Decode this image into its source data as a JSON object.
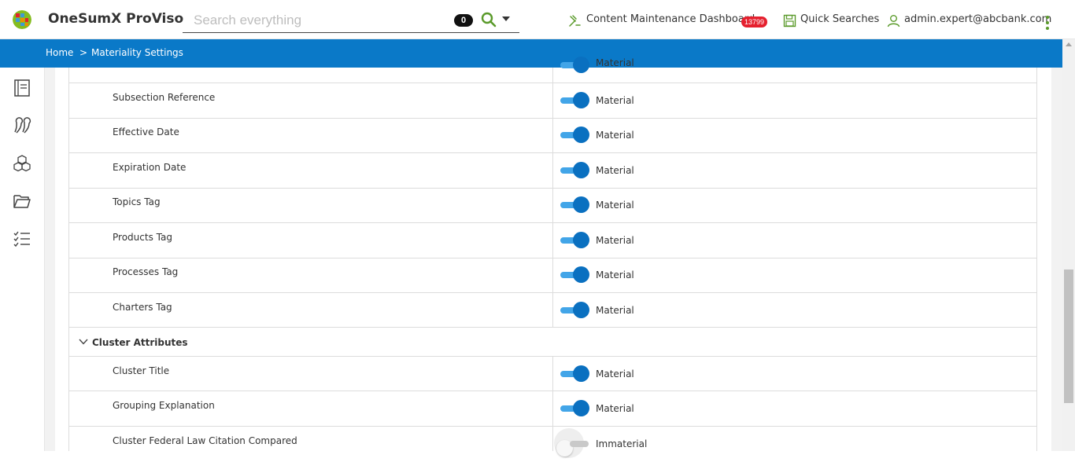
{
  "header": {
    "app_title": "OneSumX ProViso",
    "search_placeholder": "Search everything",
    "search_count": "0",
    "dashboard_label": "Content Maintenance Dashboard",
    "dashboard_badge": "13799",
    "quick_searches_label": "Quick Searches",
    "user_label": "admin.expert@abcbank.com"
  },
  "breadcrumb": {
    "home": "Home",
    "separator": ">",
    "current": "Materiality Settings"
  },
  "colors": {
    "brand_blue": "#0a79c8",
    "toggle_on": "#0a70c0",
    "badge_red": "#e5202e",
    "icon_green": "#5a9a2a"
  },
  "rows": [
    {
      "label": "Subsection Reference",
      "status": "Material"
    },
    {
      "label": "Effective Date",
      "status": "Material"
    },
    {
      "label": "Expiration Date",
      "status": "Material"
    },
    {
      "label": "Topics Tag",
      "status": "Material"
    },
    {
      "label": "Products Tag",
      "status": "Material"
    },
    {
      "label": "Processes Tag",
      "status": "Material"
    },
    {
      "label": "Charters Tag",
      "status": "Material"
    }
  ],
  "partial_top_status": "Material",
  "section": {
    "label": "Cluster Attributes"
  },
  "cluster_rows": [
    {
      "label": "Cluster Title",
      "status": "Material"
    },
    {
      "label": "Grouping Explanation",
      "status": "Material"
    },
    {
      "label": "Cluster Federal Law Citation Compared",
      "status": "Immaterial"
    }
  ]
}
